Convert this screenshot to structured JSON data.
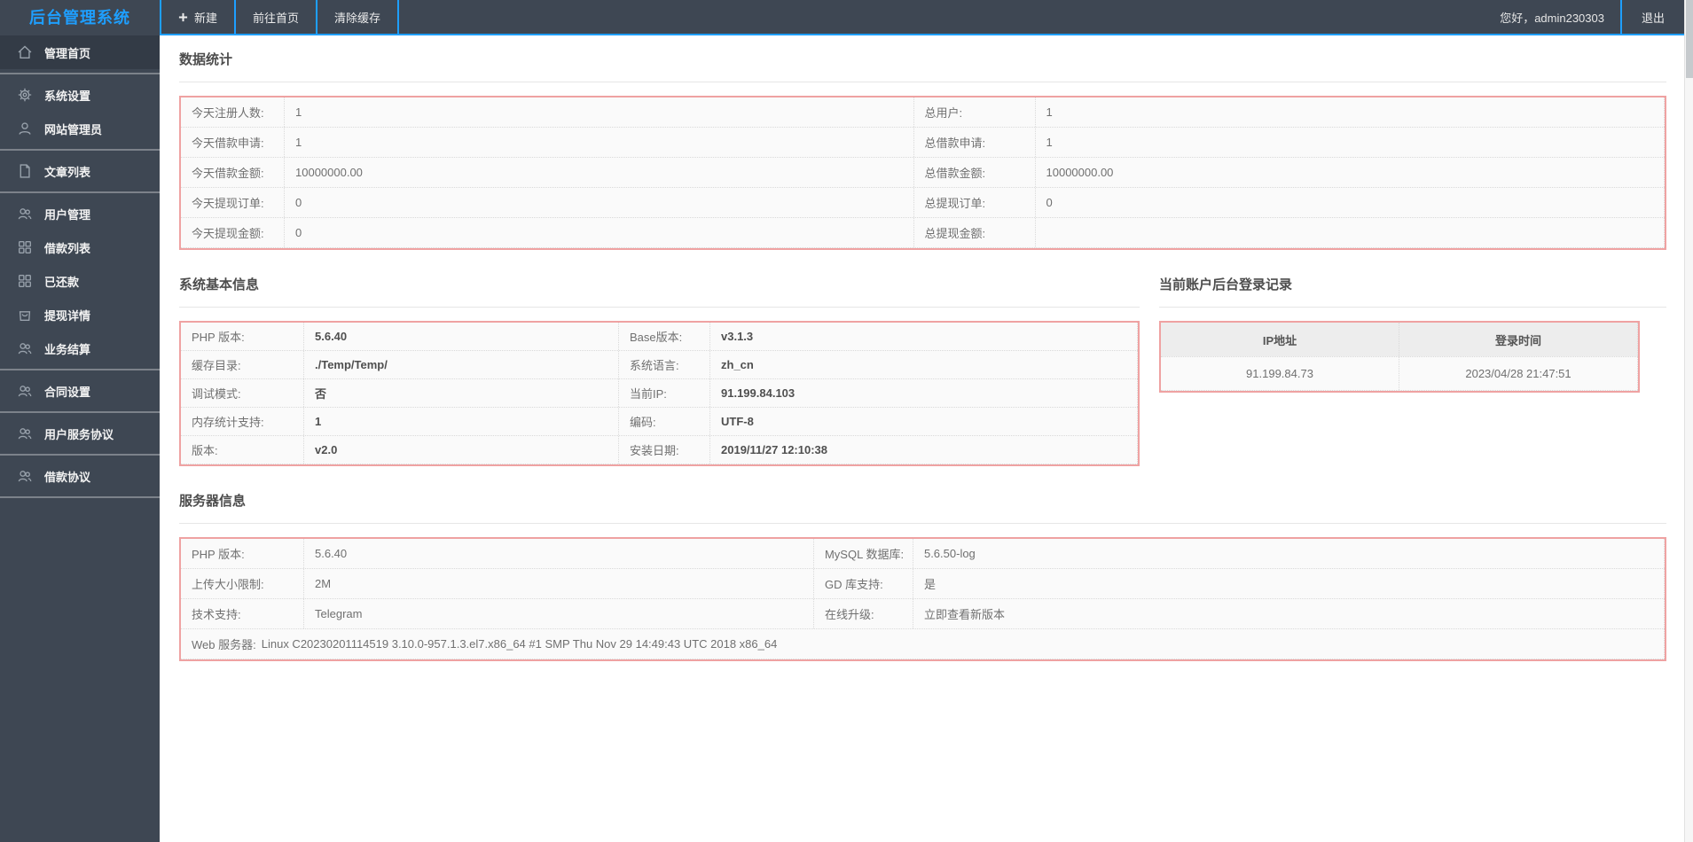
{
  "colors": {
    "accent_blue": "#1E9FFF",
    "bar_bg": "#3E4753",
    "table_border_red": "#EFA2A2",
    "cell_bg": "#FAFAFA"
  },
  "header": {
    "logo": "后台管理系统",
    "nav_new": "新建",
    "nav_home": "前往首页",
    "nav_clear_cache": "清除缓存",
    "greeting": "您好，admin230303",
    "logout": "退出"
  },
  "sidebar": {
    "items": [
      {
        "label": "管理首页",
        "icon": "home-icon",
        "active": true
      },
      {
        "label": "系统设置",
        "icon": "gear-icon"
      },
      {
        "label": "网站管理员",
        "icon": "user-icon"
      },
      {
        "label": "文章列表",
        "icon": "file-icon"
      },
      {
        "label": "用户管理",
        "icon": "users-icon"
      },
      {
        "label": "借款列表",
        "icon": "grid-icon"
      },
      {
        "label": "已还款",
        "icon": "grid-icon"
      },
      {
        "label": "提现详情",
        "icon": "bag-icon"
      },
      {
        "label": "业务结算",
        "icon": "users-icon"
      },
      {
        "label": "合同设置",
        "icon": "users-icon"
      },
      {
        "label": "用户服务协议",
        "icon": "users-icon"
      },
      {
        "label": "借款协议",
        "icon": "users-icon"
      }
    ]
  },
  "stats": {
    "title": "数据统计",
    "rows": [
      {
        "label1": "今天注册人数:",
        "value1": "1",
        "label2": "总用户:",
        "value2": "1"
      },
      {
        "label1": "今天借款申请:",
        "value1": "1",
        "label2": "总借款申请:",
        "value2": "1"
      },
      {
        "label1": "今天借款金额:",
        "value1": "10000000.00",
        "label2": "总借款金额:",
        "value2": "10000000.00"
      },
      {
        "label1": "今天提现订单:",
        "value1": "0",
        "label2": "总提现订单:",
        "value2": "0"
      },
      {
        "label1": "今天提现金额:",
        "value1": "0",
        "label2": "总提现金额:",
        "value2": ""
      }
    ]
  },
  "sysinfo": {
    "title": "系统基本信息",
    "rows": [
      {
        "label1": "PHP 版本:",
        "value1": "5.6.40",
        "label2": "Base版本:",
        "value2": "v3.1.3"
      },
      {
        "label1": "缓存目录:",
        "value1": "./Temp/Temp/",
        "label2": "系统语言:",
        "value2": "zh_cn"
      },
      {
        "label1": "调试模式:",
        "value1": "否",
        "label2": "当前IP:",
        "value2": "91.199.84.103"
      },
      {
        "label1": "内存统计支持:",
        "value1": "1",
        "label2": "编码:",
        "value2": "UTF-8"
      },
      {
        "label1": "版本:",
        "value1": "v2.0",
        "label2": "安装日期:",
        "value2": "2019/11/27 12:10:38"
      }
    ]
  },
  "login_log": {
    "title": "当前账户后台登录记录",
    "headers": [
      "IP地址",
      "登录时间"
    ],
    "rows": [
      [
        "91.199.84.73",
        "2023/04/28 21:47:51"
      ]
    ]
  },
  "server": {
    "title": "服务器信息",
    "rows": [
      {
        "label1": "PHP 版本:",
        "value1": "5.6.40",
        "label2": "MySQL 数据库:",
        "value2": "5.6.50-log"
      },
      {
        "label1": "上传大小限制:",
        "value1": "2M",
        "label2": "GD 库支持:",
        "value2": "是"
      },
      {
        "label1": "技术支持:",
        "value1": "Telegram",
        "label2": "在线升级:",
        "value2": "立即查看新版本"
      }
    ],
    "footer_label": "Web 服务器:",
    "footer_value": "Linux C20230201114519 3.10.0-957.1.3.el7.x86_64 #1 SMP Thu Nov 29 14:49:43 UTC 2018 x86_64"
  }
}
